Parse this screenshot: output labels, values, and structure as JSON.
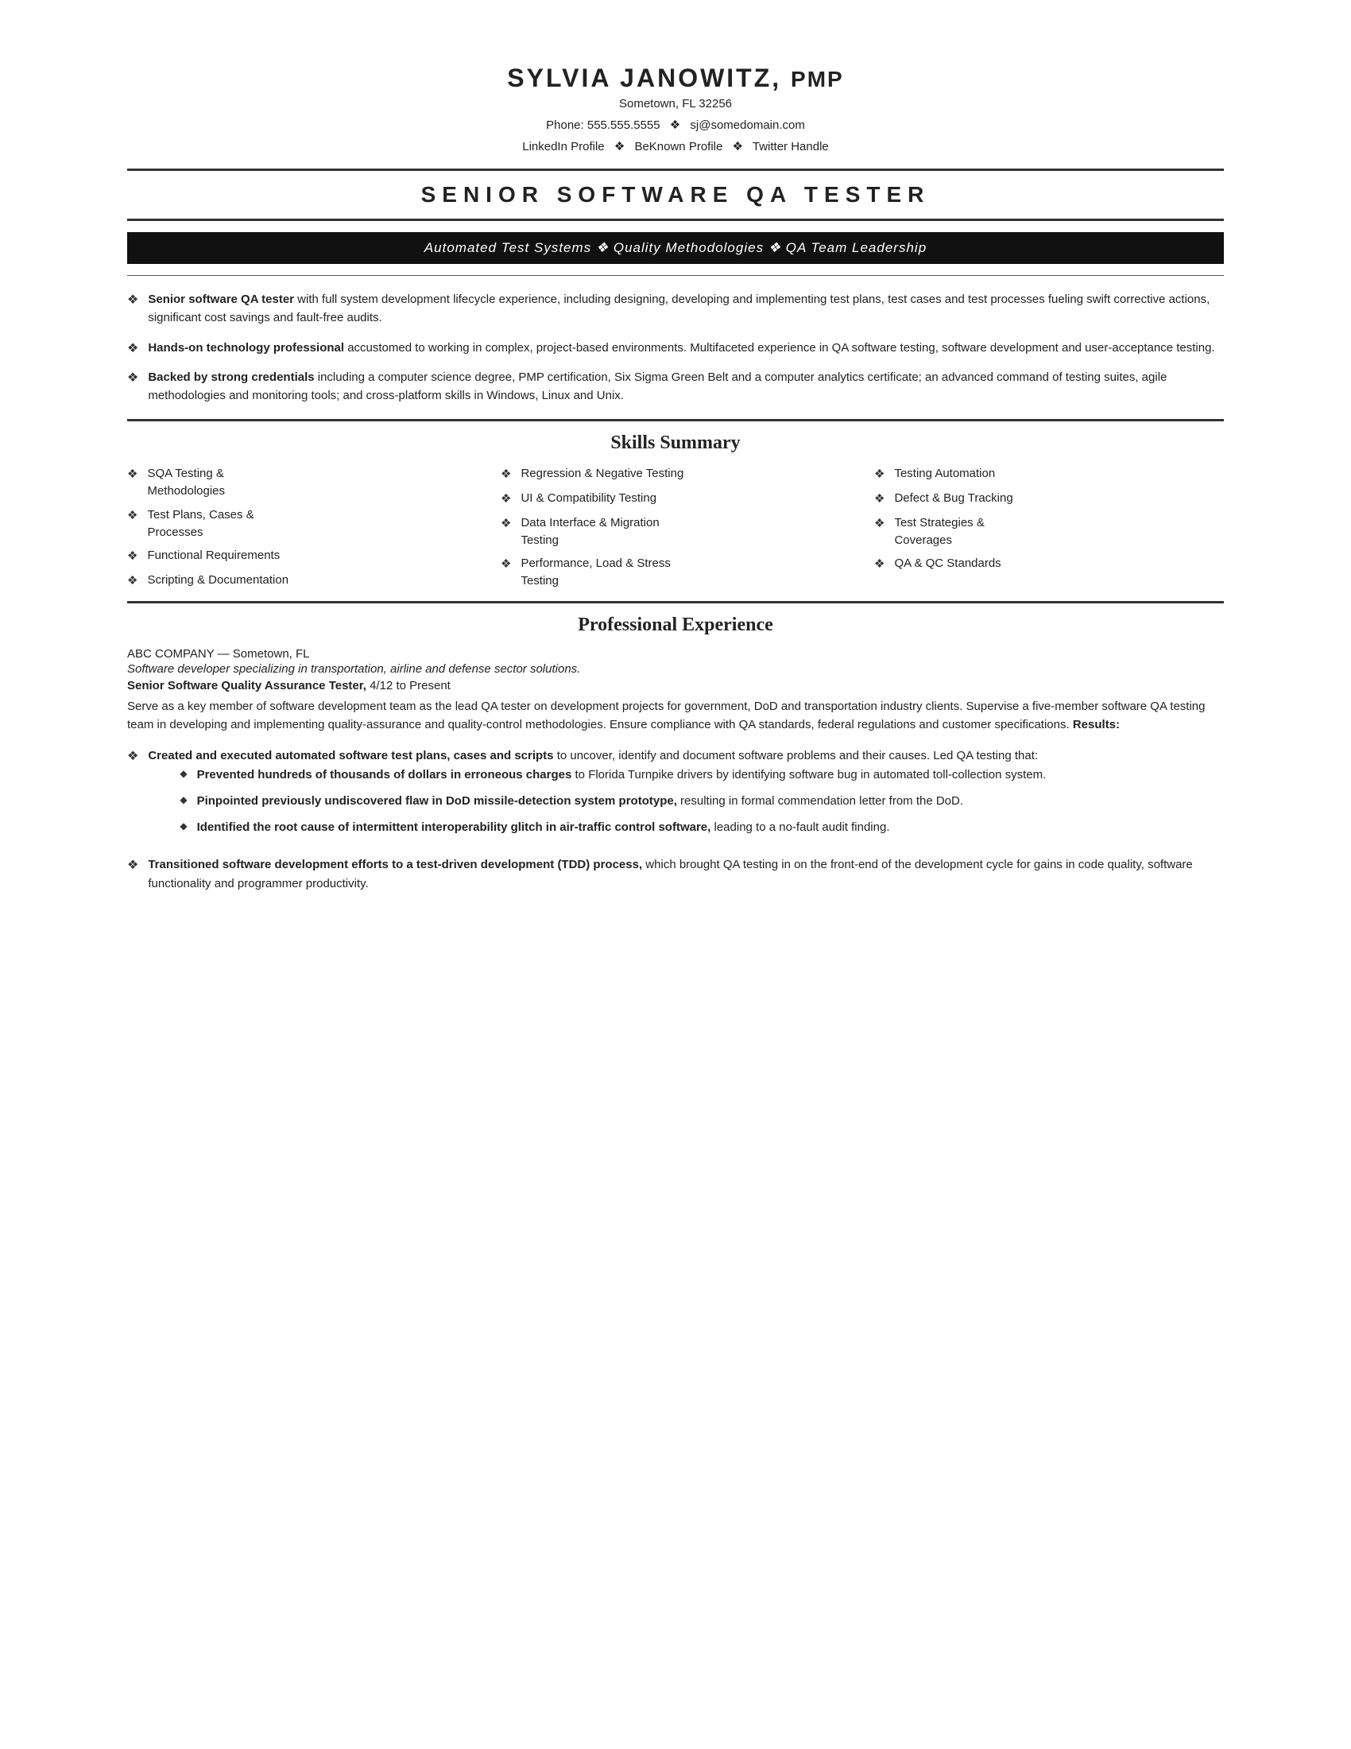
{
  "header": {
    "name": "SYLVIA JANOWITZ,",
    "credential": "PMP",
    "location": "Sometown, FL 32256",
    "phone_label": "Phone: 555.555.5555",
    "sep1": "❖",
    "email": "sj@somedomain.com",
    "linkedin": "LinkedIn Profile",
    "sep2": "❖",
    "beknown": "BeKnown Profile",
    "sep3": "❖",
    "twitter": "Twitter Handle"
  },
  "job_title": "SENIOR  SOFTWARE  QA  TESTER",
  "tagline": "Automated Test Systems  ❖  Quality Methodologies  ❖  QA Team Leadership",
  "summary": {
    "items": [
      {
        "bold": "Senior software QA tester",
        "text": " with full system development lifecycle experience, including designing, developing and implementing test plans, test cases and test processes fueling swift corrective actions, significant cost savings and fault-free audits."
      },
      {
        "bold": "Hands-on technology professional",
        "text": " accustomed to working in complex, project-based environments. Multifaceted experience in QA software testing, software development and user-acceptance testing."
      },
      {
        "bold": "Backed by strong credentials",
        "text": " including a computer science degree, PMP certification, Six Sigma Green Belt and a computer analytics certificate; an advanced command of testing suites, agile methodologies and monitoring tools; and cross-platform skills in Windows, Linux and Unix."
      }
    ]
  },
  "skills_section": {
    "title": "Skills Summary",
    "columns": [
      [
        "SQA Testing &\nMethodologies",
        "Test Plans, Cases &\nProcesses",
        "Functional Requirements",
        "Scripting & Documentation"
      ],
      [
        "Regression & Negative Testing",
        "UI & Compatibility Testing",
        "Data Interface & Migration\nTesting",
        "Performance, Load & Stress\nTesting"
      ],
      [
        "Testing Automation",
        "Defect & Bug Tracking",
        "Test Strategies &\nCoverages",
        "QA & QC Standards"
      ]
    ]
  },
  "experience_section": {
    "title": "Professional Experience",
    "jobs": [
      {
        "company": "ABC COMPANY — Sometown, FL",
        "tagline": "Software developer specializing in transportation, airline and defense sector solutions.",
        "role_bold": "Senior Software Quality Assurance Tester,",
        "role_date": " 4/12 to Present",
        "description": "Serve as a key member of software development team as the lead QA tester on development projects for government, DoD and transportation industry clients. Supervise a five-member software QA testing team in developing and implementing quality-assurance and quality-control methodologies. Ensure compliance with QA standards, federal regulations and customer specifications.",
        "results_label": "Results:",
        "bullets": [
          {
            "bold": "Created and executed automated software test plans, cases and scripts",
            "text": " to uncover, identify and document software problems and their causes. Led QA testing that:",
            "sub_bullets": [
              {
                "bold": "Prevented hundreds of thousands of dollars in erroneous charges",
                "text": " to Florida Turnpike drivers by identifying software bug in automated toll-collection system."
              },
              {
                "bold": "Pinpointed previously undiscovered flaw in DoD missile-detection system prototype,",
                "text": " resulting in formal commendation letter from the DoD."
              },
              {
                "bold": "Identified the root cause of intermittent interoperability glitch in air-traffic control software,",
                "text": " leading to a no-fault audit finding."
              }
            ]
          },
          {
            "bold": "Transitioned software development efforts to a test-driven development (TDD) process,",
            "text": " which brought QA testing in on the front-end of the development cycle for gains in code quality, software functionality and programmer productivity.",
            "sub_bullets": []
          }
        ]
      }
    ]
  }
}
